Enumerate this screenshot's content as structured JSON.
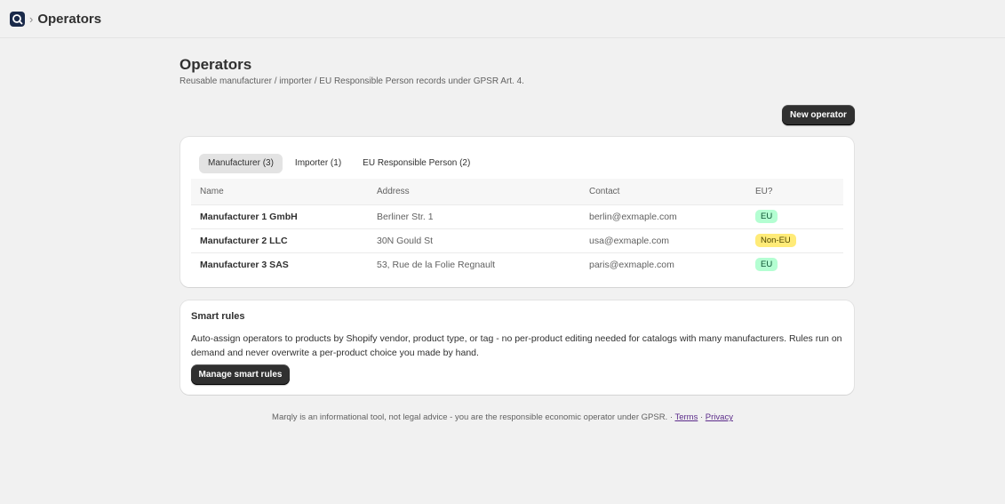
{
  "header": {
    "crumb_separator": "›",
    "title": "Operators",
    "app_icon": "marqly-logo-icon"
  },
  "page": {
    "title": "Operators",
    "subtitle": "Reusable manufacturer / importer / EU Responsible Person records under GPSR Art. 4.",
    "new_button": "New operator"
  },
  "tabs": [
    {
      "label": "Manufacturer (3)",
      "active": true
    },
    {
      "label": "Importer (1)",
      "active": false
    },
    {
      "label": "EU Responsible Person (2)",
      "active": false
    }
  ],
  "table": {
    "columns": [
      "Name",
      "Address",
      "Contact",
      "EU?"
    ],
    "rows": [
      {
        "name": "Manufacturer 1 GmbH",
        "address": "Berliner Str. 1",
        "contact": "berlin@exmaple.com",
        "eu": "EU"
      },
      {
        "name": "Manufacturer 2 LLC",
        "address": "30N Gould St",
        "contact": "usa@exmaple.com",
        "eu": "Non-EU"
      },
      {
        "name": "Manufacturer 3 SAS",
        "address": "53, Rue de la Folie Regnault",
        "contact": "paris@exmaple.com",
        "eu": "EU"
      }
    ]
  },
  "smart_rules": {
    "title": "Smart rules",
    "text": "Auto-assign operators to products by Shopify vendor, product type, or tag - no per-product editing needed for catalogs with many manufacturers. Rules run on demand and never overwrite a per-product choice you made by hand.",
    "button": "Manage smart rules"
  },
  "footer": {
    "text": "Marqly is an informational tool, not legal advice - you are the responsible economic operator under GPSR. · ",
    "terms": "Terms",
    "sep": " · ",
    "privacy": "Privacy"
  },
  "colors": {
    "eu_badge": "#b4fed2",
    "non_eu_badge": "#ffeb78",
    "primary_button": "#303030"
  }
}
